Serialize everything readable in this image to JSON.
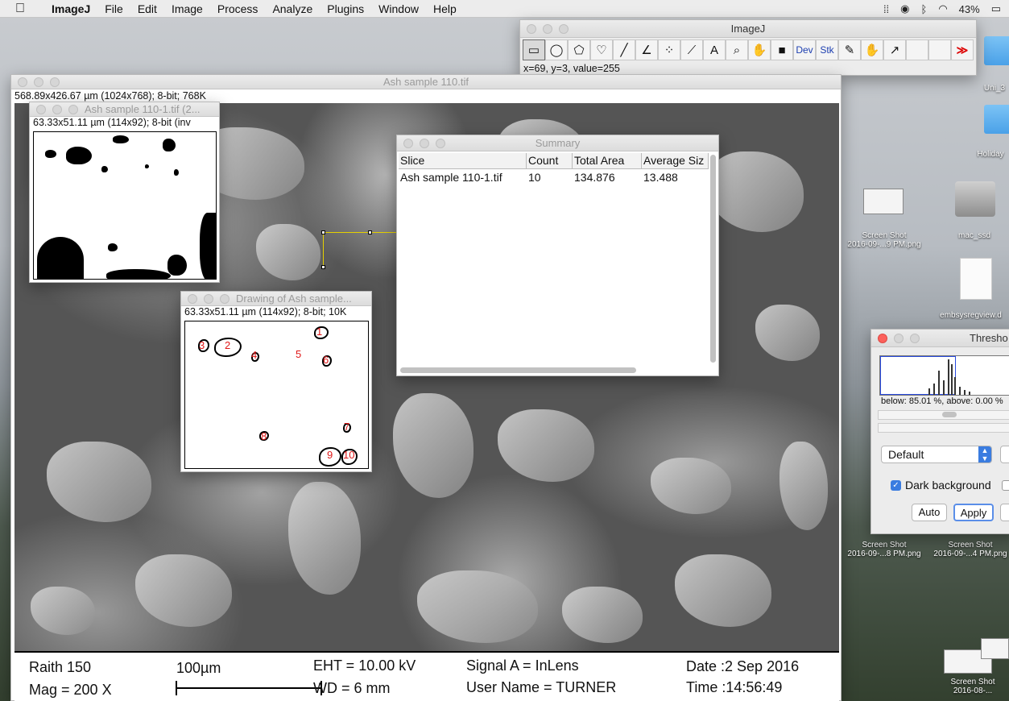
{
  "menubar": {
    "app": "ImageJ",
    "items": [
      "File",
      "Edit",
      "Image",
      "Process",
      "Analyze",
      "Plugins",
      "Window",
      "Help"
    ],
    "battery": "43%"
  },
  "toolbar": {
    "title": "ImageJ",
    "dev_label": "Dev",
    "stk_label": "Stk",
    "more_label": "≫",
    "status": "x=69, y=3, value=255"
  },
  "main_window": {
    "title": "Ash sample 110.tif",
    "info": "568.89x426.67 µm (1024x768); 8-bit; 768K",
    "sem": {
      "instrument": "Raith 150",
      "mag": "Mag =    200 X",
      "scale_label": "100µm",
      "eht": "EHT = 10.00 kV",
      "wd": "WD =     6 mm",
      "signal": "Signal A = InLens",
      "user": "User Name = TURNER",
      "date": "Date :2 Sep 2016",
      "time": "Time :14:56:49"
    }
  },
  "threshold_window": {
    "title": "Ash sample 110-1.tif (2...",
    "info": "63.33x51.11 µm (114x92); 8-bit (inv"
  },
  "drawing_window": {
    "title": "Drawing of Ash sample...",
    "info": "63.33x51.11 µm (114x92); 8-bit; 10K",
    "labels": [
      "1",
      "2",
      "3",
      "4",
      "5",
      "6",
      "7",
      "8",
      "9",
      "10"
    ]
  },
  "summary": {
    "title": "Summary",
    "columns": [
      "Slice",
      "Count",
      "Total Area",
      "Average Siz"
    ],
    "rows": [
      [
        "Ash sample 110-1.tif",
        "10",
        "134.876",
        "13.488"
      ]
    ]
  },
  "threshold_dialog": {
    "title": "Thresho",
    "stats": "below: 85.01 %,  above: 0.00 %",
    "method": "Default",
    "dark_background_label": "Dark background",
    "dark_background_checked": true,
    "auto_label": "Auto",
    "apply_label": "Apply"
  },
  "desktop": {
    "items": [
      {
        "label": "Uni_3",
        "kind": "folder"
      },
      {
        "label": "Holiday",
        "kind": "folder"
      },
      {
        "label": "Screen Shot\n2016-09-...9 PM.png",
        "kind": "screenshot"
      },
      {
        "label": "mac_ssd",
        "kind": "drive"
      },
      {
        "label": "embsysregview.d",
        "kind": "document"
      },
      {
        "label": "Screen Shot\n2016-09-...8 PM.png",
        "kind": "screenshot"
      },
      {
        "label": "Screen Shot\n2016-09-...4 PM.png",
        "kind": "screenshot"
      },
      {
        "label": "Screen Shot\n2016-08-...",
        "kind": "screenshot"
      }
    ]
  },
  "colors": {
    "accent": "#3a7ce0",
    "label_red": "#e01818",
    "roi_yellow": "#e5d000"
  }
}
